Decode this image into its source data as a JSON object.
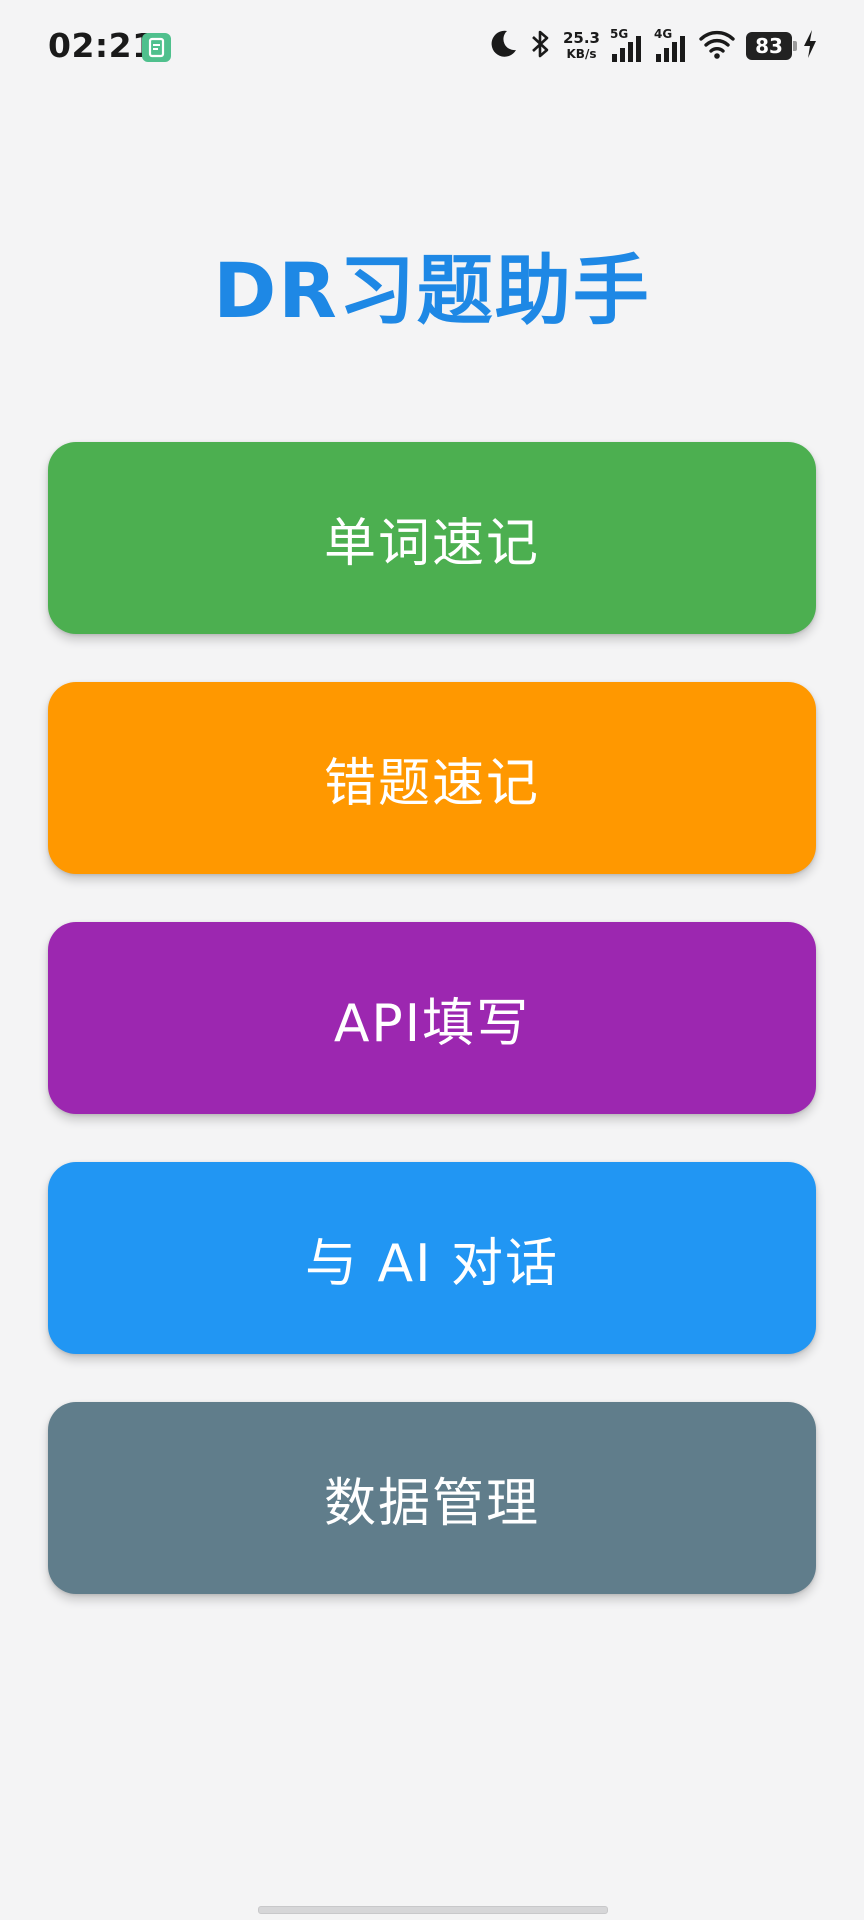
{
  "status_bar": {
    "time": "02:21",
    "net_speed_value": "25.3",
    "net_speed_unit": "KB/s",
    "sim1_tech": "5G",
    "sim2_tech": "4G",
    "battery_level": "83",
    "icons": [
      "moon-icon",
      "bluetooth-icon",
      "wifi-icon",
      "charging-bolt-icon"
    ]
  },
  "app": {
    "title": "DR习题助手"
  },
  "menu": {
    "buttons": [
      {
        "label": "单词速记",
        "color": "#4caf50"
      },
      {
        "label": "错题速记",
        "color": "#ff9800"
      },
      {
        "label": "API填写",
        "color": "#9c27b0"
      },
      {
        "label": "与 AI 对话",
        "color": "#2196f3"
      },
      {
        "label": "数据管理",
        "color": "#607d8b"
      }
    ]
  }
}
